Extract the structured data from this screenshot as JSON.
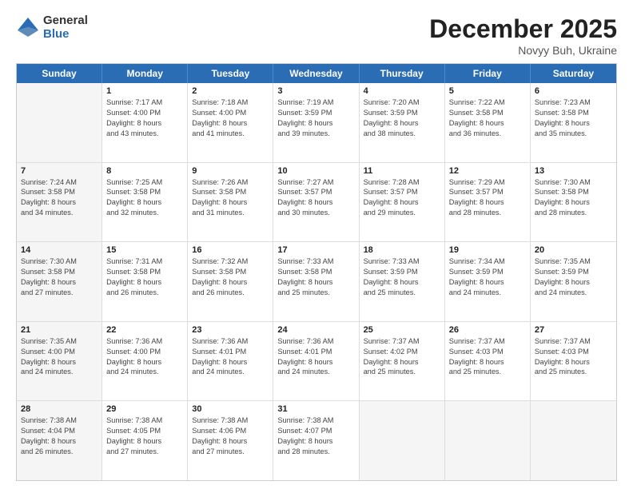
{
  "logo": {
    "general": "General",
    "blue": "Blue"
  },
  "title": "December 2025",
  "subtitle": "Novyy Buh, Ukraine",
  "headers": [
    "Sunday",
    "Monday",
    "Tuesday",
    "Wednesday",
    "Thursday",
    "Friday",
    "Saturday"
  ],
  "weeks": [
    [
      {
        "day": "",
        "lines": [],
        "shaded": true
      },
      {
        "day": "1",
        "lines": [
          "Sunrise: 7:17 AM",
          "Sunset: 4:00 PM",
          "Daylight: 8 hours",
          "and 43 minutes."
        ]
      },
      {
        "day": "2",
        "lines": [
          "Sunrise: 7:18 AM",
          "Sunset: 4:00 PM",
          "Daylight: 8 hours",
          "and 41 minutes."
        ]
      },
      {
        "day": "3",
        "lines": [
          "Sunrise: 7:19 AM",
          "Sunset: 3:59 PM",
          "Daylight: 8 hours",
          "and 39 minutes."
        ]
      },
      {
        "day": "4",
        "lines": [
          "Sunrise: 7:20 AM",
          "Sunset: 3:59 PM",
          "Daylight: 8 hours",
          "and 38 minutes."
        ]
      },
      {
        "day": "5",
        "lines": [
          "Sunrise: 7:22 AM",
          "Sunset: 3:58 PM",
          "Daylight: 8 hours",
          "and 36 minutes."
        ]
      },
      {
        "day": "6",
        "lines": [
          "Sunrise: 7:23 AM",
          "Sunset: 3:58 PM",
          "Daylight: 8 hours",
          "and 35 minutes."
        ]
      }
    ],
    [
      {
        "day": "7",
        "lines": [
          "Sunrise: 7:24 AM",
          "Sunset: 3:58 PM",
          "Daylight: 8 hours",
          "and 34 minutes."
        ],
        "shaded": true
      },
      {
        "day": "8",
        "lines": [
          "Sunrise: 7:25 AM",
          "Sunset: 3:58 PM",
          "Daylight: 8 hours",
          "and 32 minutes."
        ]
      },
      {
        "day": "9",
        "lines": [
          "Sunrise: 7:26 AM",
          "Sunset: 3:58 PM",
          "Daylight: 8 hours",
          "and 31 minutes."
        ]
      },
      {
        "day": "10",
        "lines": [
          "Sunrise: 7:27 AM",
          "Sunset: 3:57 PM",
          "Daylight: 8 hours",
          "and 30 minutes."
        ]
      },
      {
        "day": "11",
        "lines": [
          "Sunrise: 7:28 AM",
          "Sunset: 3:57 PM",
          "Daylight: 8 hours",
          "and 29 minutes."
        ]
      },
      {
        "day": "12",
        "lines": [
          "Sunrise: 7:29 AM",
          "Sunset: 3:57 PM",
          "Daylight: 8 hours",
          "and 28 minutes."
        ]
      },
      {
        "day": "13",
        "lines": [
          "Sunrise: 7:30 AM",
          "Sunset: 3:58 PM",
          "Daylight: 8 hours",
          "and 28 minutes."
        ]
      }
    ],
    [
      {
        "day": "14",
        "lines": [
          "Sunrise: 7:30 AM",
          "Sunset: 3:58 PM",
          "Daylight: 8 hours",
          "and 27 minutes."
        ],
        "shaded": true
      },
      {
        "day": "15",
        "lines": [
          "Sunrise: 7:31 AM",
          "Sunset: 3:58 PM",
          "Daylight: 8 hours",
          "and 26 minutes."
        ]
      },
      {
        "day": "16",
        "lines": [
          "Sunrise: 7:32 AM",
          "Sunset: 3:58 PM",
          "Daylight: 8 hours",
          "and 26 minutes."
        ]
      },
      {
        "day": "17",
        "lines": [
          "Sunrise: 7:33 AM",
          "Sunset: 3:58 PM",
          "Daylight: 8 hours",
          "and 25 minutes."
        ]
      },
      {
        "day": "18",
        "lines": [
          "Sunrise: 7:33 AM",
          "Sunset: 3:59 PM",
          "Daylight: 8 hours",
          "and 25 minutes."
        ]
      },
      {
        "day": "19",
        "lines": [
          "Sunrise: 7:34 AM",
          "Sunset: 3:59 PM",
          "Daylight: 8 hours",
          "and 24 minutes."
        ]
      },
      {
        "day": "20",
        "lines": [
          "Sunrise: 7:35 AM",
          "Sunset: 3:59 PM",
          "Daylight: 8 hours",
          "and 24 minutes."
        ]
      }
    ],
    [
      {
        "day": "21",
        "lines": [
          "Sunrise: 7:35 AM",
          "Sunset: 4:00 PM",
          "Daylight: 8 hours",
          "and 24 minutes."
        ],
        "shaded": true
      },
      {
        "day": "22",
        "lines": [
          "Sunrise: 7:36 AM",
          "Sunset: 4:00 PM",
          "Daylight: 8 hours",
          "and 24 minutes."
        ]
      },
      {
        "day": "23",
        "lines": [
          "Sunrise: 7:36 AM",
          "Sunset: 4:01 PM",
          "Daylight: 8 hours",
          "and 24 minutes."
        ]
      },
      {
        "day": "24",
        "lines": [
          "Sunrise: 7:36 AM",
          "Sunset: 4:01 PM",
          "Daylight: 8 hours",
          "and 24 minutes."
        ]
      },
      {
        "day": "25",
        "lines": [
          "Sunrise: 7:37 AM",
          "Sunset: 4:02 PM",
          "Daylight: 8 hours",
          "and 25 minutes."
        ]
      },
      {
        "day": "26",
        "lines": [
          "Sunrise: 7:37 AM",
          "Sunset: 4:03 PM",
          "Daylight: 8 hours",
          "and 25 minutes."
        ]
      },
      {
        "day": "27",
        "lines": [
          "Sunrise: 7:37 AM",
          "Sunset: 4:03 PM",
          "Daylight: 8 hours",
          "and 25 minutes."
        ]
      }
    ],
    [
      {
        "day": "28",
        "lines": [
          "Sunrise: 7:38 AM",
          "Sunset: 4:04 PM",
          "Daylight: 8 hours",
          "and 26 minutes."
        ],
        "shaded": true
      },
      {
        "day": "29",
        "lines": [
          "Sunrise: 7:38 AM",
          "Sunset: 4:05 PM",
          "Daylight: 8 hours",
          "and 27 minutes."
        ]
      },
      {
        "day": "30",
        "lines": [
          "Sunrise: 7:38 AM",
          "Sunset: 4:06 PM",
          "Daylight: 8 hours",
          "and 27 minutes."
        ]
      },
      {
        "day": "31",
        "lines": [
          "Sunrise: 7:38 AM",
          "Sunset: 4:07 PM",
          "Daylight: 8 hours",
          "and 28 minutes."
        ]
      },
      {
        "day": "",
        "lines": [],
        "shaded": true
      },
      {
        "day": "",
        "lines": [],
        "shaded": true
      },
      {
        "day": "",
        "lines": [],
        "shaded": true
      }
    ]
  ]
}
